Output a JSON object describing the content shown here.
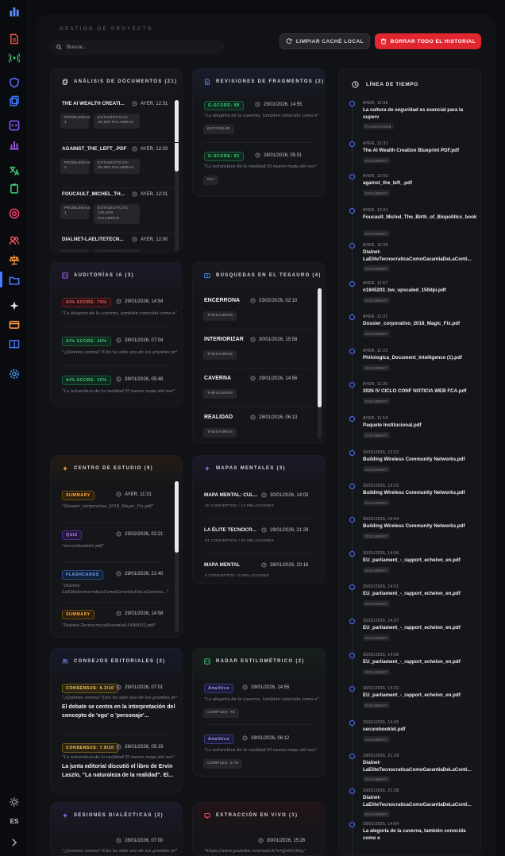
{
  "sidebar": {
    "language": "ES",
    "icons": [
      {
        "name": "logo-icon",
        "color": "#5b8cff"
      },
      {
        "name": "document-icon",
        "color": "#e0533d"
      },
      {
        "name": "broadcast-icon",
        "color": "#3ed07a"
      },
      {
        "name": "shield-icon",
        "color": "#5b6cff"
      },
      {
        "name": "copy-icon",
        "color": "#3d7bff"
      },
      {
        "name": "code-icon",
        "color": "#8a5cff"
      },
      {
        "name": "bar-chart-icon",
        "color": "#b25cff"
      },
      {
        "name": "translate-icon",
        "color": "#3ed07a"
      },
      {
        "name": "clipboard-icon",
        "color": "#3ed07a"
      },
      {
        "name": "target-icon",
        "color": "#ff3d6b"
      },
      {
        "name": "users-icon",
        "color": "#ff5b5b"
      },
      {
        "name": "scale-icon",
        "color": "#ff9a3d"
      },
      {
        "name": "folder-icon",
        "color": "#4b78ff"
      },
      {
        "name": "sparkle-icon",
        "color": "#e6e7ea"
      },
      {
        "name": "card-icon",
        "color": "#ff9a3d"
      },
      {
        "name": "book-icon",
        "color": "#4b78ff"
      },
      {
        "name": "settings-icon",
        "color": "#4b9bff"
      },
      {
        "name": "sun-icon",
        "color": "#9a9ca4"
      },
      {
        "name": "chevron-right-icon",
        "color": "#9a9ca4"
      }
    ]
  },
  "header": {
    "section_label": "GESTIÓN DE PROYECTO",
    "search_placeholder": "Buscar...",
    "clear_cache_label": "LIMPIAR CACHÉ LOCAL",
    "delete_all_label": "BORRAR TODO EL HISTORIAL"
  },
  "cards": {
    "docs": {
      "title": "ANÁLISIS DE DOCUMENTOS (21)",
      "items": [
        {
          "name": "THE AI WEALTH CREATI...",
          "date": "AYER, 12:31",
          "problems": "PROBLEMAS: 4",
          "stats": "ESTADÍSTICAS: 25,000 PALABRAS"
        },
        {
          "name": "AGAINST_THE_LEFT_.PDF",
          "date": "AYER, 12:03",
          "problems": "PROBLEMAS: 2",
          "stats": "ESTADÍSTICAS: 30,000 PALABRAS"
        },
        {
          "name": "FOUCAULT_MICHEL_TH...",
          "date": "AYER, 12:01",
          "problems": "PROBLEMAS: 1",
          "stats": "ESTADÍSTICAS: 120,000 PALABRAS"
        },
        {
          "name": "DIALNET-LAELITETECN...",
          "date": "AYER, 12:00",
          "problems": "PROBLEMAS:",
          "stats": "ESTADÍSTICAS:"
        }
      ]
    },
    "fragments": {
      "title": "REVISIONES DE FRAGMENTOS (2)",
      "items": [
        {
          "badge": "G-SCORE: 88",
          "date": "29/01/2026, 14:55",
          "quote": "\"La alegoría de la caverna, también conocida como e\"",
          "tag": "ESTÁNDAR"
        },
        {
          "badge": "G-SCORE: 82",
          "date": "28/01/2026, 05:51",
          "quote": "\"La naturaleza de la realidad El nuevo mapa del ess\"",
          "tag": "N/A"
        }
      ]
    },
    "audits": {
      "title": "AUDITORÍAS IA (3)",
      "items": [
        {
          "badge": "AI% SCORE: 75%",
          "date": "29/01/2026, 14:54",
          "quote": "\"La alegoría de la caverna, también conocida como e\""
        },
        {
          "badge": "AI% SCORE: 40%",
          "date": "28/01/2026, 07:04",
          "quote": "\"¿Quiénes somos? Esto ha sido uno de los grandes pr\""
        },
        {
          "badge": "AI% SCORE: 20%",
          "date": "28/01/2026, 05:48",
          "quote": "\"La naturaleza de la realidad El nuevo mapa del ess\""
        }
      ]
    },
    "thesaurus": {
      "title": "BÚSQUEDAS EN EL TESAURO (4)",
      "items": [
        {
          "word": "ENCERRONA",
          "date": "23/02/2026, 02:10",
          "tag": "THESAURUS"
        },
        {
          "word": "INTERIORIZAR",
          "date": "30/01/2026, 15:58",
          "tag": "THESAURUS"
        },
        {
          "word": "CAVERNA",
          "date": "29/01/2026, 14:56",
          "tag": "THESAURUS"
        },
        {
          "word": "REALIDAD",
          "date": "28/01/2026, 06:13",
          "tag": "THESAURUS"
        }
      ]
    },
    "study": {
      "title": "CENTRO DE ESTUDIO (9)",
      "items": [
        {
          "badge": "SUMMARY",
          "date": "AYER, 11:31",
          "quote": "\"Dossier_corporativo_2018_Magic_Fix.pdf\""
        },
        {
          "badge": "QUIZ",
          "date": "23/02/2026, 02:21",
          "quote": "\"securebooklet.pdf\""
        },
        {
          "badge": "FLASHCARDS",
          "date": "29/01/2026, 21:40",
          "quote": "\"Dialnet-LaElitetecnocraticaComoGarantiaDeLaContinu...\""
        },
        {
          "badge": "SUMMARY",
          "date": "29/01/2026, 14:58",
          "quote": "\"Dialnet-TecnocraciaSociedad-5496053.pdf\""
        }
      ]
    },
    "mindmaps": {
      "title": "MAPAS MENTALES (3)",
      "items": [
        {
          "name": "MAPA MENTAL: CUL...",
          "date": "30/01/2026, 14:03",
          "detail": "20 CONCEPTOS / 12 RELACIONES"
        },
        {
          "name": "LA ÉLITE TECNOCR...",
          "date": "29/01/2026, 21:29",
          "detail": "21 CONCEPTOS / 20 RELACIONES"
        },
        {
          "name": "MAPA MENTAL",
          "date": "28/01/2026, 20:16",
          "detail": "0 CONCEPTOS / 0 RELACIONES"
        }
      ]
    },
    "councils": {
      "title": "CONSEJOS EDITORIALES (2)",
      "items": [
        {
          "badge": "CONSENSUS: 6.3/10",
          "date": "29/01/2026, 07:01",
          "quote": "\"¿Quiénes somos? Esto ha sido uno de los grandes pr\"",
          "text": "El debate se centra en la interpretación del concepto de 'ego' o 'personaje'..."
        },
        {
          "badge": "CONSENSUS: 7.8/10",
          "date": "28/01/2026, 05:19",
          "quote": "\"La naturaleza de la realidad El nuevo mapa del ess\"",
          "text": "La junta editorial discutió el libro de Ervin Laszlo, \"La naturaleza de la realidad\". El..."
        }
      ]
    },
    "radar": {
      "title": "RADAR ESTILOMÉTRICO (2)",
      "items": [
        {
          "badge": "Analítico",
          "date": "29/01/2026, 14:55",
          "quote": "\"La alegoría de la caverna, también conocida como e\"",
          "tag": "COMPLEX: 75"
        },
        {
          "badge": "Analítico",
          "date": "28/01/2026, 06:12",
          "quote": "\"La naturaleza de la realidad El nuevo mapa del ess\"",
          "tag": "COMPLEX: 0.75"
        }
      ]
    },
    "dialectic": {
      "title": "SESIONES DIALÉCTICAS (2)",
      "items": [
        {
          "date": "28/01/2026, 07:00",
          "quote": "\"¿Quiénes somos? Esto ha sido uno de los grandes pr\""
        }
      ]
    },
    "extraction": {
      "title": "EXTRACCIÓN EN VIVO (1)",
      "items": [
        {
          "date": "30/01/2026, 15:26",
          "quote": "\"https://www.youtube.com/watch?v=jjx0Grfiog\""
        }
      ]
    }
  },
  "timeline": {
    "title": "LÍNEA DE TIEMPO",
    "items": [
      {
        "date": "AYER, 12:55",
        "name": "La cultura de seguridad es esencial para la superv",
        "tag": "FLASHCARDS"
      },
      {
        "date": "AYER, 12:31",
        "name": "The AI Wealth Creation Blueprint PDF.pdf",
        "tag": "DOCUMENT"
      },
      {
        "date": "AYER, 12:03",
        "name": "against_the_left_.pdf",
        "tag": "DOCUMENT"
      },
      {
        "date": "AYER, 12:01",
        "name": "Foucault_Michel_The_Birth_of_Biopolitics_book",
        "tag": "DOCUMENT"
      },
      {
        "date": "AYER, 12:00",
        "name": "Dialnet-LaEliteTecnocraticaComoGarantiaDeLaConti...",
        "tag": "DOCUMENT"
      },
      {
        "date": "AYER, 11:57",
        "name": "n1845203_bw_upscaled_150dpi.pdf",
        "tag": "DOCUMENT"
      },
      {
        "date": "AYER, 11:31",
        "name": "Dossier_corporativo_2018_Magic_Fix.pdf",
        "tag": "DOCUMENT"
      },
      {
        "date": "AYER, 11:22",
        "name": "Philologica_Document_Intelligence (1).pdf",
        "tag": "DOCUMENT"
      },
      {
        "date": "AYER, 11:20",
        "name": "2026 IV CICLO CONF NOTICIA WEB FCA.pdf",
        "tag": "DOCUMENT"
      },
      {
        "date": "AYER, 11:14",
        "name": "Paquete Institucional.pdf",
        "tag": "DOCUMENT"
      },
      {
        "date": "30/01/2026, 15:22",
        "name": "Building Wireless Community Networks.pdf",
        "tag": "DOCUMENT"
      },
      {
        "date": "30/01/2026, 15:15",
        "name": "Building Wireless Community Networks.pdf",
        "tag": "DOCUMENT"
      },
      {
        "date": "30/01/2026, 15:04",
        "name": "Building Wireless Community Networks.pdf",
        "tag": "DOCUMENT"
      },
      {
        "date": "30/01/2026, 14:56",
        "name": "EU_parliament_-_rapport_echelon_en.pdf",
        "tag": "DOCUMENT"
      },
      {
        "date": "30/01/2026, 14:51",
        "name": "EU_parliament_-_rapport_echelon_en.pdf",
        "tag": "DOCUMENT"
      },
      {
        "date": "30/01/2026, 14:37",
        "name": "EU_parliament_-_rapport_echelon_en.pdf",
        "tag": "DOCUMENT"
      },
      {
        "date": "30/01/2026, 14:26",
        "name": "EU_parliament_-_rapport_echelon_en.pdf",
        "tag": "DOCUMENT"
      },
      {
        "date": "30/01/2026, 14:22",
        "name": "EU_parliament_-_rapport_echelon_en.pdf",
        "tag": "DOCUMENT"
      },
      {
        "date": "30/01/2026, 14:05",
        "name": "securebooklet.pdf",
        "tag": "DOCUMENT"
      },
      {
        "date": "29/01/2026, 21:29",
        "name": "Dialnet-LaEliteTecnocraticaComoGarantiaDeLaConti...",
        "tag": "DOCUMENT"
      },
      {
        "date": "29/01/2026, 21:28",
        "name": "Dialnet-LaEliteTecnocraticaComoGarantiaDeLaConti...",
        "tag": "DOCUMENT"
      },
      {
        "date": "29/01/2026, 14:54",
        "name": "La alegoría de la caverna, también conocida como e",
        "tag": ""
      }
    ]
  }
}
